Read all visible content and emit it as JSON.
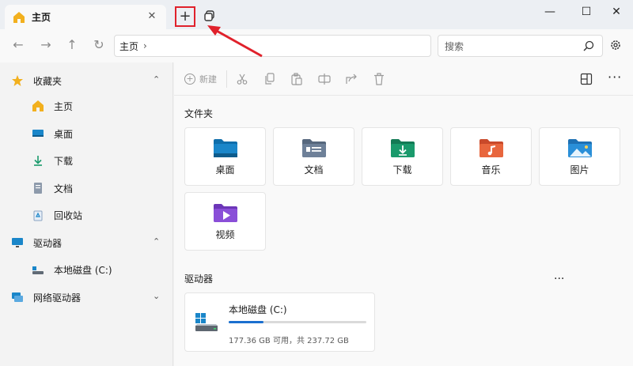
{
  "tab": {
    "title": "主页",
    "close_glyph": "✕",
    "icon": "home-icon"
  },
  "titlebar": {
    "new_tab_glyph": "+",
    "minimize": "—",
    "maximize": "☐",
    "close": "✕"
  },
  "nav": {
    "back": "←",
    "forward": "→",
    "up": "↑",
    "refresh": "↻"
  },
  "address": {
    "path": "主页",
    "separator": "›"
  },
  "search": {
    "placeholder": "搜索"
  },
  "sidebar": {
    "favorites": {
      "label": "收藏夹",
      "icon": "star-icon"
    },
    "items": [
      {
        "label": "主页",
        "icon": "home-icon"
      },
      {
        "label": "桌面",
        "icon": "desktop-icon"
      },
      {
        "label": "下载",
        "icon": "download-icon"
      },
      {
        "label": "文档",
        "icon": "document-icon"
      },
      {
        "label": "回收站",
        "icon": "recycle-bin-icon"
      }
    ],
    "drives": {
      "label": "驱动器",
      "icon": "monitor-icon"
    },
    "drive_items": [
      {
        "label": "本地磁盘 (C:)",
        "icon": "disk-icon"
      }
    ],
    "network": {
      "label": "网络驱动器",
      "icon": "network-icon"
    }
  },
  "toolbar": {
    "new_label": "新建",
    "more": "···"
  },
  "folders": {
    "title": "文件夹",
    "items": [
      {
        "label": "桌面",
        "icon": "desktop-folder-icon",
        "color": "#1a86c9"
      },
      {
        "label": "文档",
        "icon": "documents-folder-icon",
        "color": "#6e8098"
      },
      {
        "label": "下载",
        "icon": "downloads-folder-icon",
        "color": "#1a9a6c"
      },
      {
        "label": "音乐",
        "icon": "music-folder-icon",
        "color": "#e8663d"
      },
      {
        "label": "图片",
        "icon": "pictures-folder-icon",
        "color": "#2a8fd8"
      },
      {
        "label": "视频",
        "icon": "videos-folder-icon",
        "color": "#8a4fd8"
      }
    ]
  },
  "drives": {
    "title": "驱动器",
    "more": "···",
    "items": [
      {
        "name": "本地磁盘 (C:)",
        "info": "177.36 GB 可用，共 237.72 GB",
        "used_fraction": 0.254
      }
    ]
  },
  "colors": {
    "accent": "#1a6fcf",
    "highlight": "#e0212b"
  }
}
